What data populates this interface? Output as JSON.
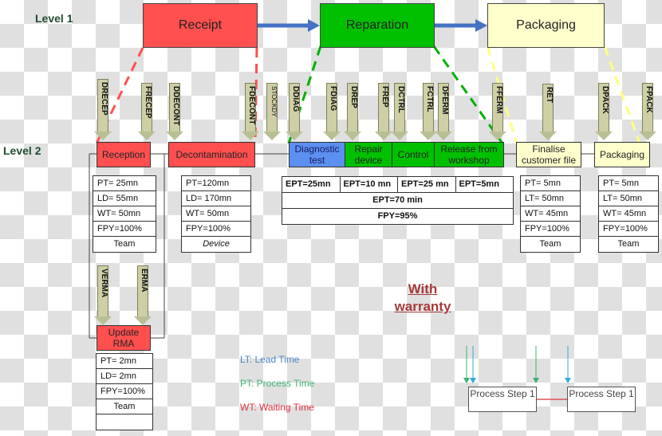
{
  "levels": {
    "level1": "Level 1",
    "level2": "Level 2"
  },
  "level1_boxes": [
    {
      "label": "Receipt",
      "color": "#ff4f4f"
    },
    {
      "label": "Reparation",
      "color": "#00c000"
    },
    {
      "label": "Packaging",
      "color": "#ffffcc"
    }
  ],
  "level2_boxes": {
    "reception": "Reception",
    "decontamination": "Decontamination",
    "diagnostic": "Diagnostic test",
    "repair": "Repair device",
    "control": "Control",
    "release": "Release from workshop",
    "finalise": "Finalise customer file",
    "packaging": "Packaging",
    "update_rma": "Update RMA"
  },
  "flow_arrows": [
    "DRECEP",
    "FRECEP",
    "DDECONT",
    "FDECONT",
    "STOCKDY",
    "DDIAG",
    "FDIAG",
    "DREP",
    "FREP",
    "DCTRL",
    "FCTRL",
    "DFERM",
    "FFERM",
    "RET",
    "DPACK",
    "FPACK",
    "VERMA",
    "ERMA"
  ],
  "tables": {
    "reception": [
      "PT= 25mn",
      "LD= 55mn",
      "WT= 50mn",
      "FPY=100%",
      "Team"
    ],
    "decontamination": [
      "PT=120mn",
      "LD= 170mn",
      "WT= 50mn",
      "FPY=100%",
      "Device"
    ],
    "finalise": [
      "PT= 5mn",
      "LT= 50mn",
      "WT= 45mn",
      "FPY=100%",
      "Team"
    ],
    "packaging": [
      "PT= 5mn",
      "LT= 50mn",
      "WT= 45mn",
      "FPY=100%",
      "Team"
    ],
    "update_rma": [
      "PT= 2mn",
      "LD= 2mn",
      "FPY=100%",
      "Team",
      ""
    ]
  },
  "reparation_table": {
    "ept_steps": [
      "EPT=25mn",
      "EPT=10 mn",
      "EPT=25 mn",
      "EPT=5mn"
    ],
    "ept_total": "EPT=70 min",
    "fpy": "FPY=95%"
  },
  "warranty": {
    "line1": "With",
    "line2": "warranty"
  },
  "legend": [
    {
      "text": "LT: Lead Time",
      "color": "#4a86c8"
    },
    {
      "text": "PT: Process Time",
      "color": "#3cb371"
    },
    {
      "text": "WT: Waiting Time",
      "color": "#e03040"
    }
  ],
  "process_steps": [
    "Process Step 1",
    "Process Step 1"
  ]
}
